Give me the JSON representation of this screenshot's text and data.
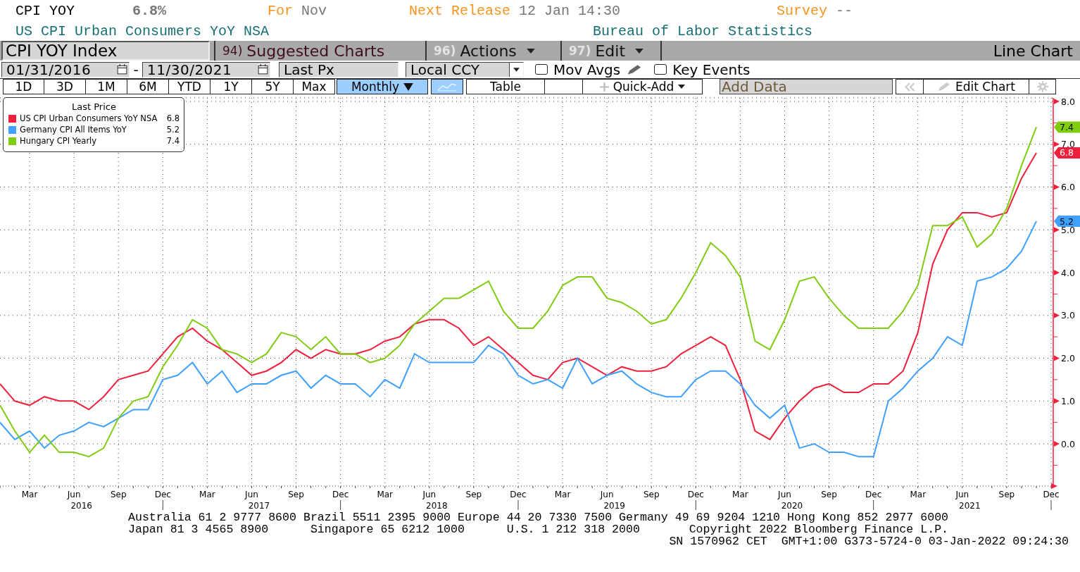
{
  "header": {
    "ticker": "CPI YOY",
    "last": "6.8%",
    "period_label": "For",
    "period": "Nov",
    "release_label": "Next Release",
    "release": "12 Jan 14:30",
    "survey_label": "Survey",
    "survey": "--",
    "description": "US CPI Urban Consumers YoY NSA",
    "source": "Bureau of Labor Statistics"
  },
  "menu_bar": {
    "security": "CPI YOY Index",
    "menus": [
      {
        "number": "94)",
        "label": "Suggested Charts",
        "kind": "suggest",
        "dropdown": false
      },
      {
        "number": "96)",
        "label": "Actions",
        "kind": "menu",
        "dropdown": true
      },
      {
        "number": "97)",
        "label": "Edit",
        "kind": "menu",
        "dropdown": true
      }
    ],
    "chart_type": "Line Chart"
  },
  "settings": {
    "start_date": "01/31/2016",
    "separator": "-",
    "end_date": "11/30/2021",
    "field": "Last Px",
    "currency": "Local CCY",
    "checkboxes": [
      {
        "label": "Mov Avgs",
        "checked": false,
        "kind": "editable"
      },
      {
        "label": "Key Events",
        "checked": false,
        "kind": "plain"
      }
    ]
  },
  "toolbar": {
    "ranges": [
      {
        "label": "1D",
        "selected": false
      },
      {
        "label": "3D",
        "selected": false
      },
      {
        "label": "1M",
        "selected": false
      },
      {
        "label": "6M",
        "selected": false
      },
      {
        "label": "YTD",
        "selected": false
      },
      {
        "label": "1Y",
        "selected": false
      },
      {
        "label": "5Y",
        "selected": false
      },
      {
        "label": "Max",
        "selected": false
      }
    ],
    "frequency": "Monthly",
    "table": "Table",
    "quick_add": "Quick-Add",
    "add_data": "Add Data",
    "edit_chart": "Edit Chart"
  },
  "chart": {
    "legend_title": "Last Price",
    "legend_values": [
      "6.8",
      "5.2",
      "7.4"
    ],
    "last_value_tags": [
      "7.4",
      "6.8",
      "5.2"
    ],
    "year_labels": [
      "2016",
      "2017",
      "2018",
      "2019",
      "2020",
      "2021"
    ],
    "chart_data": {
      "type": "line",
      "grid": true,
      "categories": [
        null,
        null,
        "Mar",
        null,
        null,
        "Jun",
        null,
        null,
        "Sep",
        null,
        null,
        "Dec",
        null,
        null,
        "Mar",
        null,
        null,
        "Jun",
        null,
        null,
        "Sep",
        null,
        null,
        "Dec",
        null,
        null,
        "Mar",
        null,
        null,
        "Jun",
        null,
        null,
        "Sep",
        null,
        null,
        "Dec",
        null,
        null,
        "Mar",
        null,
        null,
        "Jun",
        null,
        null,
        "Sep",
        null,
        null,
        "Dec",
        null,
        null,
        "Mar",
        null,
        null,
        "Jun",
        null,
        null,
        "Sep",
        null,
        null,
        "Dec",
        null,
        null,
        "Mar",
        null,
        null,
        "Jun",
        null,
        null,
        "Sep",
        null,
        null,
        "Dec"
      ],
      "series": [
        {
          "name": "US CPI Urban Consumers YoY NSA",
          "color": "#f0203c",
          "values": [
            1.4,
            1.0,
            0.9,
            1.1,
            1.0,
            1.0,
            0.8,
            1.1,
            1.5,
            1.6,
            1.7,
            2.1,
            2.5,
            2.7,
            2.4,
            2.2,
            1.9,
            1.6,
            1.7,
            1.9,
            2.2,
            2.0,
            2.2,
            2.1,
            2.1,
            2.2,
            2.4,
            2.5,
            2.8,
            2.9,
            2.9,
            2.7,
            2.3,
            2.5,
            2.2,
            1.9,
            1.6,
            1.5,
            1.9,
            2.0,
            1.8,
            1.6,
            1.8,
            1.7,
            1.7,
            1.8,
            2.1,
            2.3,
            2.5,
            2.3,
            1.5,
            0.3,
            0.1,
            0.6,
            1.0,
            1.3,
            1.4,
            1.2,
            1.2,
            1.4,
            1.4,
            1.7,
            2.6,
            4.2,
            5.0,
            5.4,
            5.4,
            5.3,
            5.4,
            6.2,
            6.8,
            null
          ]
        },
        {
          "name": "Germany CPI All Items YoY",
          "color": "#3fa0ff",
          "values": [
            0.5,
            0.1,
            0.3,
            -0.1,
            0.2,
            0.3,
            0.5,
            0.4,
            0.6,
            0.8,
            0.8,
            1.5,
            1.6,
            1.9,
            1.4,
            1.7,
            1.2,
            1.4,
            1.4,
            1.6,
            1.7,
            1.3,
            1.6,
            1.4,
            1.4,
            1.1,
            1.5,
            1.3,
            2.1,
            1.9,
            1.9,
            1.9,
            1.9,
            2.3,
            2.1,
            1.6,
            1.4,
            1.5,
            1.3,
            2.0,
            1.4,
            1.6,
            1.7,
            1.4,
            1.2,
            1.1,
            1.1,
            1.5,
            1.7,
            1.7,
            1.4,
            0.9,
            0.6,
            0.9,
            -0.1,
            0.0,
            -0.2,
            -0.2,
            -0.3,
            -0.3,
            1.0,
            1.3,
            1.7,
            2.0,
            2.5,
            2.3,
            3.8,
            3.9,
            4.1,
            4.5,
            5.2,
            null
          ]
        },
        {
          "name": "Hungary CPI Yearly",
          "color": "#80cc10",
          "values": [
            0.9,
            0.3,
            -0.2,
            0.2,
            -0.2,
            -0.2,
            -0.3,
            -0.1,
            0.6,
            1.0,
            1.1,
            1.8,
            2.3,
            2.9,
            2.7,
            2.2,
            2.1,
            1.9,
            2.1,
            2.6,
            2.5,
            2.2,
            2.5,
            2.1,
            2.1,
            1.9,
            2.0,
            2.3,
            2.8,
            3.1,
            3.4,
            3.4,
            3.6,
            3.8,
            3.1,
            2.7,
            2.7,
            3.1,
            3.7,
            3.9,
            3.9,
            3.4,
            3.3,
            3.1,
            2.8,
            2.9,
            3.4,
            4.0,
            4.7,
            4.4,
            3.9,
            2.4,
            2.2,
            2.9,
            3.8,
            3.9,
            3.4,
            3.0,
            2.7,
            2.7,
            2.7,
            3.1,
            3.7,
            5.1,
            5.1,
            5.3,
            4.6,
            4.9,
            5.5,
            6.5,
            7.4,
            null
          ]
        }
      ],
      "ylim": [
        -1,
        8
      ],
      "yticks": [
        {
          "value": 0,
          "label": "0.0"
        },
        {
          "value": 1,
          "label": "1.0"
        },
        {
          "value": 2,
          "label": "2.0"
        },
        {
          "value": 3,
          "label": "3.0"
        },
        {
          "value": 4,
          "label": "4.0"
        },
        {
          "value": 5,
          "label": "5.0"
        },
        {
          "value": 6,
          "label": "6.0"
        },
        {
          "value": 7,
          "label": "7.0"
        },
        {
          "value": 8,
          "label": "8.0"
        }
      ]
    }
  },
  "footer": [
    "Australia 61 2 9777 8600 Brazil 5511 2395 9000 Europe 44 20 7330 7500 Germany 49 69 9204 1210 Hong Kong 852 2977 6000",
    "Japan 81 3 4565 8900      Singapore 65 6212 1000      U.S. 1 212 318 2000       Copyright 2022 Bloomberg Finance L.P.",
    "SN 1570962 CET  GMT+1:00 G373-5724-0 03-Jan-2022 09:24:30"
  ]
}
